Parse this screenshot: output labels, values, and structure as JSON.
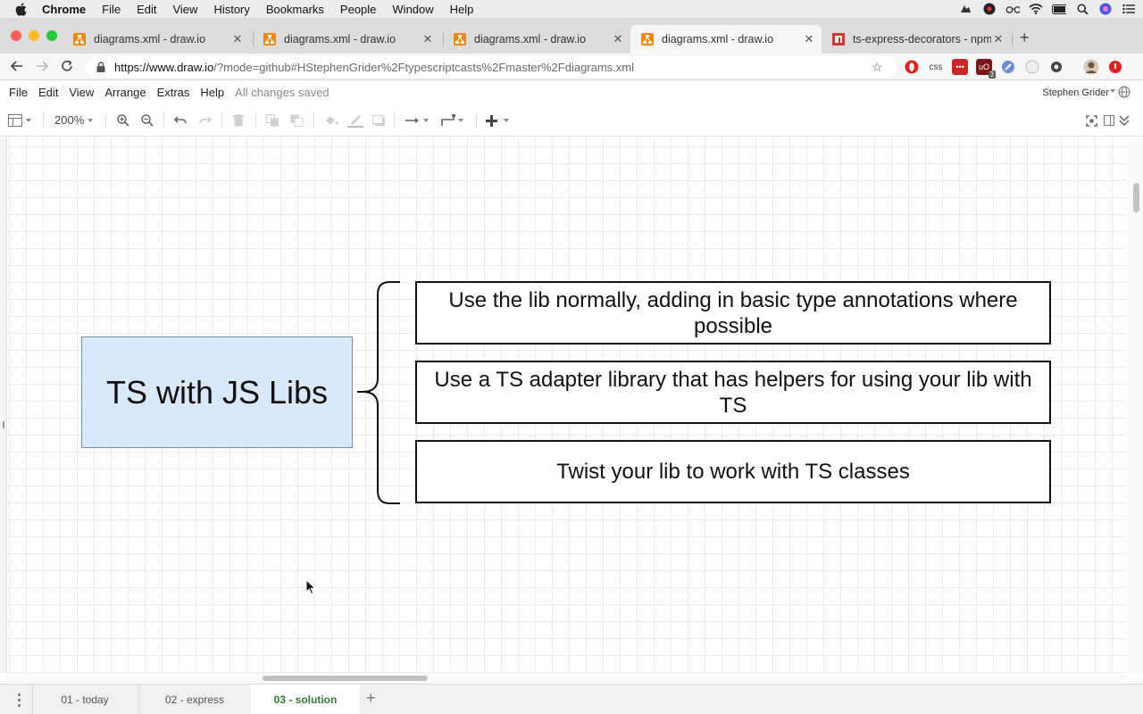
{
  "os_menubar": {
    "app": "Chrome",
    "items": [
      "File",
      "Edit",
      "View",
      "History",
      "Bookmarks",
      "People",
      "Window",
      "Help"
    ]
  },
  "browser": {
    "tabs": [
      {
        "label": "diagrams.xml - draw.io",
        "active": false
      },
      {
        "label": "diagrams.xml - draw.io",
        "active": false
      },
      {
        "label": "diagrams.xml - draw.io",
        "active": false
      },
      {
        "label": "diagrams.xml - draw.io",
        "active": true
      },
      {
        "label": "ts-express-decorators - npm",
        "active": false
      }
    ],
    "url_host": "https://www.draw.io",
    "url_rest": "/?mode=github#HStephenGrider%2Ftypescriptcasts%2Fmaster%2Fdiagrams.xml",
    "ext_css_label": "css",
    "ext_badge": "3"
  },
  "app_menu": {
    "items": [
      "File",
      "Edit",
      "View",
      "Arrange",
      "Extras",
      "Help"
    ],
    "status": "All changes saved",
    "user": "Stephen Grider"
  },
  "toolbar": {
    "zoom": "200%"
  },
  "diagram": {
    "main_box": "TS with JS Libs",
    "options": [
      "Use the lib normally, adding in basic type annotations where possible",
      "Use a TS adapter library that has helpers for using your lib with TS",
      "Twist your lib to work with TS classes"
    ]
  },
  "pages": {
    "tabs": [
      {
        "label": "01 - today",
        "active": false
      },
      {
        "label": "02 - express",
        "active": false
      },
      {
        "label": "03 - solution",
        "active": true
      }
    ]
  },
  "colors": {
    "main_box_fill": "#dae8fc",
    "main_box_stroke": "#6c8ebf",
    "active_page_tab": "#2e7d32"
  }
}
